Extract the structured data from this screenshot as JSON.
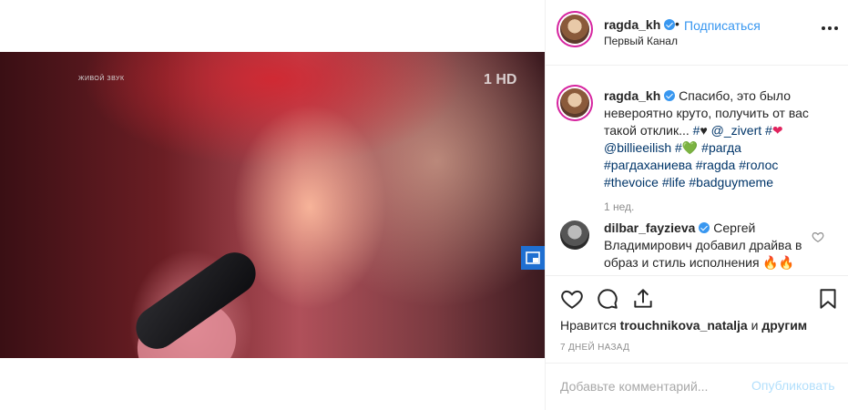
{
  "video": {
    "live_label": "ЖИВОЙ ЗВУК",
    "channel_logo": "1 HD",
    "pip_icon": "picture-in-picture-icon",
    "user_icon": "user-tag-icon"
  },
  "header": {
    "username": "ragda_kh",
    "separator": "•",
    "follow_label": "Подписаться",
    "location": "Первый Канал",
    "more_icon": "more-options-icon"
  },
  "caption": {
    "username": "ragda_kh",
    "text_1": "Спасибо, это было невероятно круто, получить от вас такой отклик... ",
    "tag_1": "#",
    "heart_1": "♥",
    "mention_1": " @_zivert",
    "tag_2": " #",
    "heart_2": "❤",
    "mention_2": "@billieeilish",
    "tag_3": " #",
    "heart_3": "💚",
    "hashtags": " #рагда #рагдаханиева #ragda #голос #thevoice #life #badguymeme",
    "time": "1 нед."
  },
  "comment": {
    "username": "dilbar_fayzieva",
    "text": " Сергей Владимирович добавил драйва в образ и стиль исполнения 🔥🔥"
  },
  "actions": {
    "likes_prefix": "Нравится ",
    "likes_user": "trouchnikova_natalja",
    "likes_suffix": " и ",
    "likes_others": "другим",
    "date": "7 ДНЕЙ НАЗАД"
  },
  "add_comment": {
    "placeholder": "Добавьте комментарий...",
    "publish_label": "Опубликовать"
  },
  "colors": {
    "accent": "#3897f0",
    "link": "#003569",
    "muted": "#8e8e8e",
    "publish_disabled": "#b2dffc"
  }
}
